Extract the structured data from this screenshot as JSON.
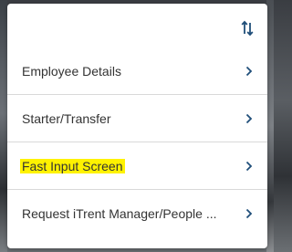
{
  "header": {
    "sort_icon": "sort-arrows-icon"
  },
  "menu": {
    "items": [
      {
        "label": "Employee Details",
        "icon": "chevron-right-icon",
        "highlighted": false
      },
      {
        "label": "Starter/Transfer",
        "icon": "chevron-right-icon",
        "highlighted": false
      },
      {
        "label": "Fast Input Screen",
        "icon": "chevron-right-icon",
        "highlighted": true
      },
      {
        "label": "Request iTrent Manager/People ...",
        "icon": "chevron-right-icon",
        "highlighted": false
      }
    ]
  },
  "colors": {
    "accent": "#1f4e79",
    "highlight": "#fff200",
    "text": "#333333",
    "divider": "#d9d9d9"
  }
}
